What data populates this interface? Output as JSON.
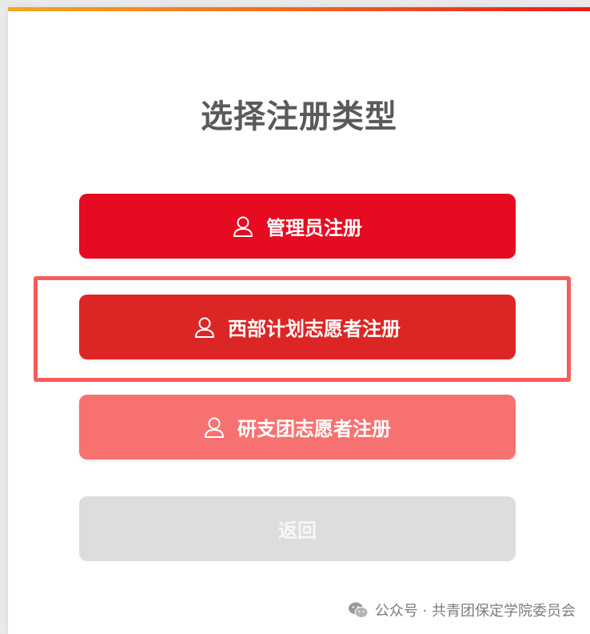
{
  "page": {
    "title": "选择注册类型"
  },
  "buttons": {
    "admin": {
      "label": "管理员注册",
      "icon": "user-icon",
      "color": "#e60b20"
    },
    "western_volunteer": {
      "label": "西部计划志愿者注册",
      "icon": "user-icon",
      "color": "#dc2626"
    },
    "graduate_volunteer": {
      "label": "研支团志愿者注册",
      "icon": "user-icon",
      "color": "#f87171"
    },
    "back": {
      "label": "返回",
      "color": "#dddddd"
    }
  },
  "watermark": {
    "text": "公众号 · 共青团保定学院委员会",
    "icon": "wechat-icon"
  },
  "colors": {
    "accent_gradient": [
      "#f5a623",
      "#ea1b1b"
    ],
    "highlight_border": "#f75b5b",
    "title_text": "#5a5a5a"
  }
}
